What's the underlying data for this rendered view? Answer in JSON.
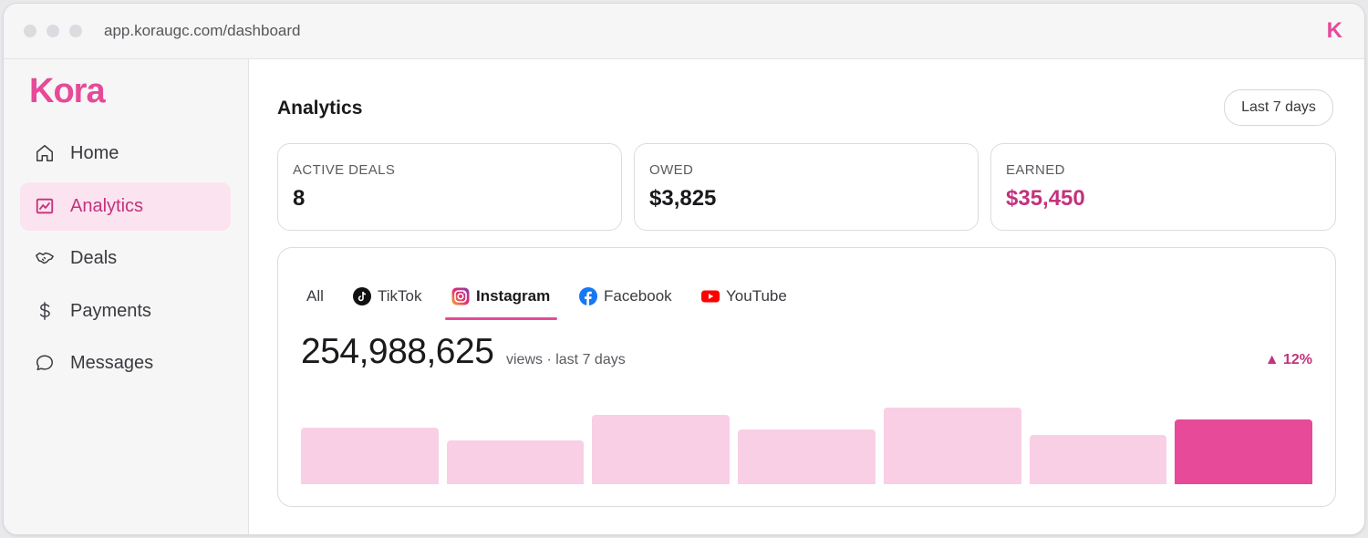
{
  "browser": {
    "url": "app.koraugc.com/dashboard",
    "brand_mark": "K"
  },
  "sidebar": {
    "logo": "Kora",
    "items": [
      {
        "label": "Home",
        "icon": "home-icon",
        "active": false
      },
      {
        "label": "Analytics",
        "icon": "chart-icon",
        "active": true
      },
      {
        "label": "Deals",
        "icon": "handshake-icon",
        "active": false
      },
      {
        "label": "Payments",
        "icon": "dollar-icon",
        "active": false
      },
      {
        "label": "Messages",
        "icon": "chat-bubble-icon",
        "active": false
      }
    ]
  },
  "header": {
    "title": "Analytics",
    "range_button": "Last 7 days"
  },
  "stats": [
    {
      "label": "ACTIVE DEALS",
      "value": "8"
    },
    {
      "label": "OWED",
      "value": "$3,825"
    },
    {
      "label": "EARNED",
      "value": "$35,450"
    }
  ],
  "platform_tabs": [
    {
      "label": "All",
      "icon": "",
      "active": false
    },
    {
      "label": "TikTok",
      "icon": "tiktok-icon",
      "active": false
    },
    {
      "label": "Instagram",
      "icon": "instagram-icon",
      "active": true
    },
    {
      "label": "Facebook",
      "icon": "facebook-icon",
      "active": false
    },
    {
      "label": "YouTube",
      "icon": "youtube-icon",
      "active": false
    }
  ],
  "views": {
    "total": "254,988,625",
    "caption": "views · last 7 days",
    "delta": "▲ 12%"
  },
  "colors": {
    "accent": "#e64a98",
    "accent_text": "#c2337e",
    "bar_light": "#f9cfe5",
    "bar_highlight": "#e64a98"
  },
  "chart_data": {
    "type": "bar",
    "values": [
      57,
      44,
      70,
      55,
      77,
      50,
      65
    ],
    "highlight_index": 6
  }
}
